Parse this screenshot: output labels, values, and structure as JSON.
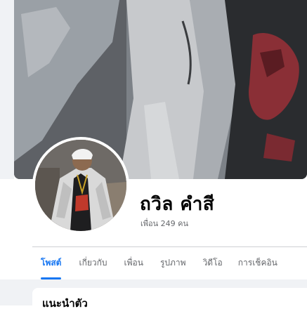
{
  "profile": {
    "name": "ถวิล คำสี",
    "friends": "เพื่อน 249 คน"
  },
  "tabs": [
    {
      "label": "โพสต์",
      "active": true
    },
    {
      "label": "เกี่ยวกับ",
      "active": false
    },
    {
      "label": "เพื่อน",
      "active": false
    },
    {
      "label": "รูปภาพ",
      "active": false
    },
    {
      "label": "วิดีโอ",
      "active": false
    },
    {
      "label": "การเช็คอิน",
      "active": false
    }
  ],
  "intro": {
    "title": "แนะนำตัว"
  },
  "colors": {
    "accent": "#1877f2",
    "text_primary": "#050505",
    "text_secondary": "#65676b",
    "feed_bg": "#f0f2f5"
  }
}
